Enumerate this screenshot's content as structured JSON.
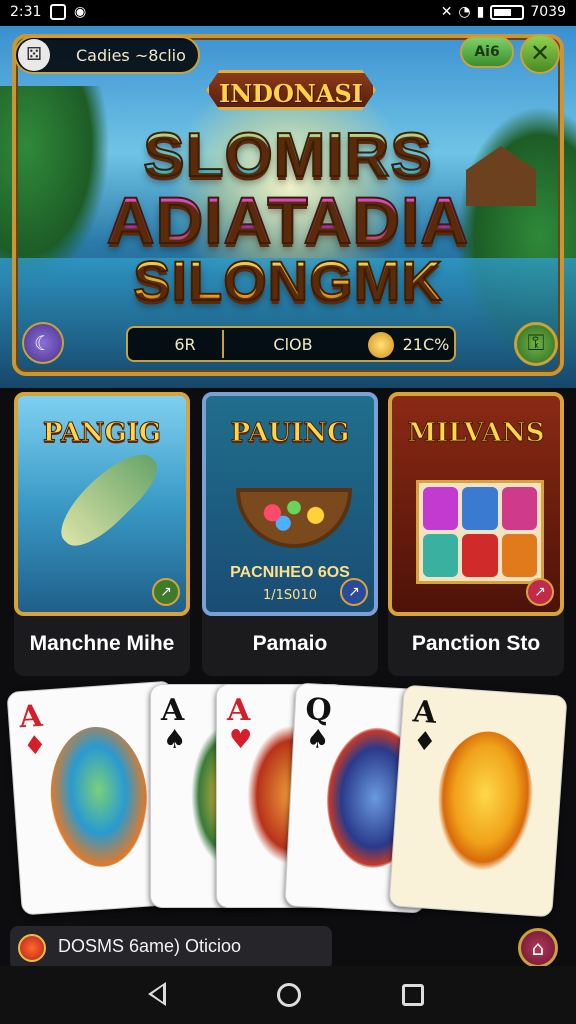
{
  "status_bar": {
    "time": "2:31",
    "right_text": "7039"
  },
  "hero": {
    "user_label": "Cadies ~8clio",
    "level_label": "Ai6",
    "badge": "INDONASI",
    "logo_line1": "SLOMIRS",
    "logo_line2": "ADIATADIA",
    "logo_line3": "SILONGMK",
    "info_1": "6R",
    "info_2": "ClOB",
    "info_3": "21C%",
    "colors": {
      "frame": "#c99636",
      "accent_green": "#4a8a23"
    }
  },
  "games": [
    {
      "art_title": "PANGIG",
      "caption": "Manchne Mihe"
    },
    {
      "art_title": "PAUING",
      "art_sub": "PACNIHEO 6OS",
      "art_sub2": "1/1S010",
      "caption": "Pamaio"
    },
    {
      "art_title": "MILVANS",
      "caption": "Panction Sto"
    }
  ],
  "playing_cards": [
    {
      "rank": "A",
      "suit": "♦"
    },
    {
      "rank": "A",
      "suit": "♠"
    },
    {
      "rank": "A",
      "suit": "♥"
    },
    {
      "rank": "Q",
      "suit": "♠"
    },
    {
      "rank": "A",
      "suit": "♦"
    }
  ],
  "bottom_bar": {
    "text": "DOSMS 6ame) Oticioo"
  },
  "icons": {
    "avatar": "dice-icon",
    "close": "close-icon",
    "left_round": "moon-icon",
    "right_round": "chest-icon",
    "home": "home-icon"
  }
}
